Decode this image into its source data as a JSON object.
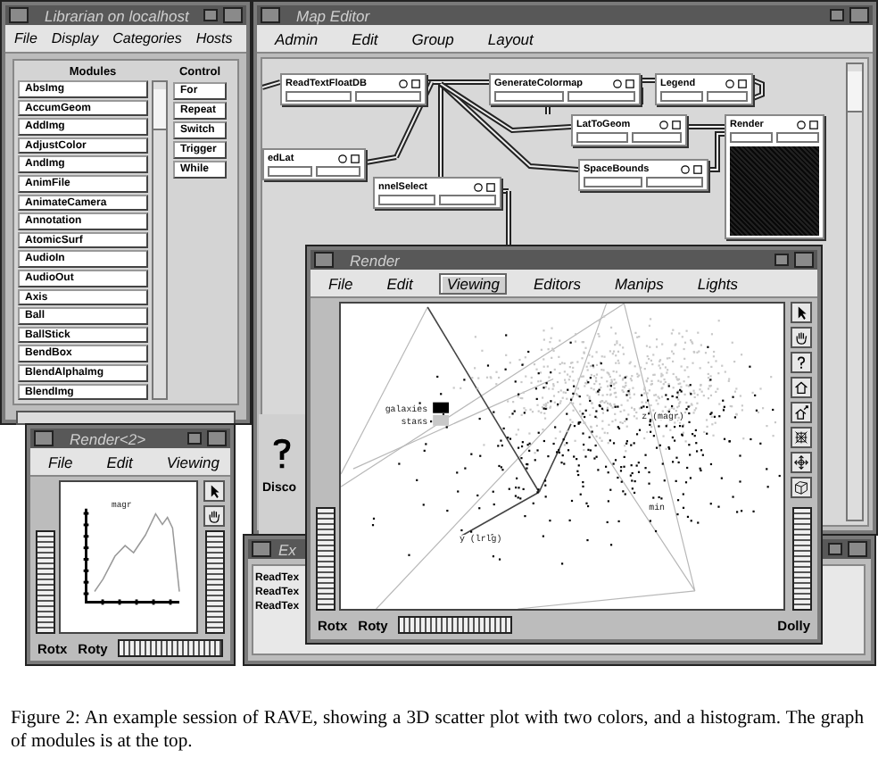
{
  "librarian": {
    "title": "Librarian on localhost",
    "menu": [
      "File",
      "Display",
      "Categories",
      "Hosts"
    ],
    "modules_header": "Modules",
    "modules": [
      "AbsImg",
      "AccumGeom",
      "AddImg",
      "AdjustColor",
      "AndImg",
      "AnimFile",
      "AnimateCamera",
      "Annotation",
      "AtomicSurf",
      "AudioIn",
      "AudioOut",
      "Axis",
      "Ball",
      "BallStick",
      "BendBox",
      "BlendAlphaImg",
      "BlendImg"
    ],
    "control_header": "Control",
    "controls": [
      "For",
      "Repeat",
      "Switch",
      "Trigger",
      "While"
    ]
  },
  "map_editor": {
    "title": "Map Editor",
    "menu": [
      "Admin",
      "Edit",
      "Group",
      "Layout"
    ],
    "modules": [
      {
        "label": "ReadTextFloatDB",
        "kind": "module"
      },
      {
        "label": "GenerateColormap",
        "kind": "module"
      },
      {
        "label": "Legend",
        "kind": "module"
      },
      {
        "label": "LatToGeom",
        "kind": "module"
      },
      {
        "label": "Render",
        "kind": "render"
      },
      {
        "label": "edLat",
        "kind": "module"
      },
      {
        "label": "nnelSelect",
        "kind": "module"
      },
      {
        "label": "SpaceBounds",
        "kind": "module"
      }
    ]
  },
  "side_panel": {
    "label": "Disco"
  },
  "explorer_window": {
    "title": "Ex",
    "lines": [
      "ReadTex",
      "ReadTex",
      "ReadTex"
    ]
  },
  "render": {
    "title": "Render",
    "menu": [
      {
        "label": "File",
        "selected": false
      },
      {
        "label": "Edit",
        "selected": false
      },
      {
        "label": "Viewing",
        "selected": true
      },
      {
        "label": "Editors",
        "selected": false
      },
      {
        "label": "Manips",
        "selected": false
      },
      {
        "label": "Lights",
        "selected": false
      }
    ],
    "legend": [
      {
        "label": "galaxies",
        "color": "#000000"
      },
      {
        "label": "stars",
        "color": "#c8c8c8"
      }
    ],
    "axis_labels": [
      "z (magr)",
      "min",
      "y (lrlg)"
    ],
    "controls": [
      "Rotx",
      "Roty",
      "Dolly"
    ]
  },
  "render2": {
    "title": "Render<2>",
    "menu": [
      "File",
      "Edit",
      "Viewing"
    ],
    "plot_label": "magr",
    "controls": [
      "Rotx",
      "Roty"
    ]
  },
  "caption": "Figure 2: An example session of RAVE, showing a 3D scatter plot with two colors, and a histogram. The graph of modules is at the top."
}
